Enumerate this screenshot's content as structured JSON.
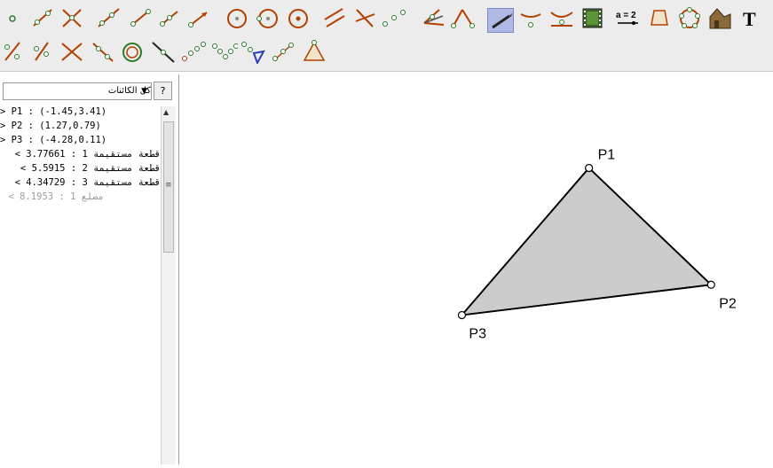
{
  "toolbar": {
    "tools": [
      {
        "name": "move-tool-icon",
        "active": false
      },
      {
        "name": "point-tool-icon",
        "active": false
      },
      {
        "name": "line-tool-icon",
        "active": false
      },
      {
        "name": "intersect-tool-icon",
        "active": false
      },
      {
        "name": "ray-tool-icon",
        "active": false
      },
      {
        "name": "segment-tool-icon",
        "active": false
      },
      {
        "name": "vector-tool-icon",
        "active": false
      },
      {
        "name": "circle-center-point-icon",
        "active": false
      },
      {
        "name": "circle-three-points-icon",
        "active": false
      },
      {
        "name": "circle-radius-icon",
        "active": false
      },
      {
        "name": "parallel-line-icon",
        "active": false
      },
      {
        "name": "perpendicular-line-icon",
        "active": false
      },
      {
        "name": "midpoint-icon",
        "active": false
      },
      {
        "name": "angle-bisector-icon",
        "active": false
      },
      {
        "name": "angle-icon",
        "active": false
      },
      {
        "name": "pen-tool-icon",
        "active": true
      },
      {
        "name": "curve-tool-icon",
        "active": false
      },
      {
        "name": "locus-tool-icon",
        "active": false
      },
      {
        "name": "film-icon",
        "active": false
      },
      {
        "name": "equation-icon",
        "active": false
      },
      {
        "name": "polygon-icon",
        "active": false
      },
      {
        "name": "regular-polygon-icon",
        "active": false
      },
      {
        "name": "house-icon",
        "active": false
      },
      {
        "name": "text-tool-icon",
        "active": false
      },
      {
        "name": "slope-icon",
        "active": false
      },
      {
        "name": "ratio-icon",
        "active": false
      },
      {
        "name": "cross-lines-icon",
        "active": false
      },
      {
        "name": "line-through-points-icon",
        "active": false
      },
      {
        "name": "circle-on-line-icon",
        "active": false
      },
      {
        "name": "diagonal-line-icon",
        "active": false
      },
      {
        "name": "dotted-curve-icon",
        "active": false
      },
      {
        "name": "wave-points-icon",
        "active": false
      },
      {
        "name": "triangle-marker-icon",
        "active": false
      },
      {
        "name": "scatter-points-icon",
        "active": false
      },
      {
        "name": "triangle-tool-icon",
        "active": false
      }
    ],
    "equation_label": "a = 2"
  },
  "sidebar": {
    "filter_value": "كل الكائنات",
    "help_label": "?",
    "objects": [
      {
        "text": "> P1 : (-1.45,3.41)",
        "dim": false
      },
      {
        "text": "> P2 : (1.27,0.79)",
        "dim": false
      },
      {
        "text": "> P3 : (-4.28,0.11)",
        "dim": false
      },
      {
        "text": "قطعة مستقيمة 1 : 3.77661 >",
        "dim": false
      },
      {
        "text": "قطعة مستقيمة 2 : 5.5915 >",
        "dim": false
      },
      {
        "text": "قطعة مستقيمة 3 : 4.34729 >",
        "dim": false
      },
      {
        "text": "مضلع 1 : 8.1953 >",
        "dim": true
      }
    ]
  },
  "canvas": {
    "points": [
      {
        "label": "P1",
        "x": -1.45,
        "y": 3.41
      },
      {
        "label": "P2",
        "x": 1.27,
        "y": 0.79
      },
      {
        "label": "P3",
        "x": -4.28,
        "y": 0.11
      }
    ],
    "polygon_fill": "#cccccc",
    "stroke_color": "#000000"
  }
}
